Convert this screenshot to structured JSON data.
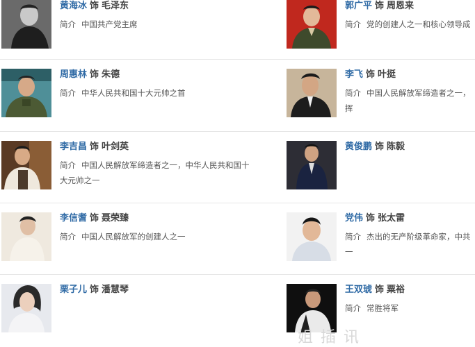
{
  "cast": [
    {
      "left": {
        "actor": "黄海冰",
        "as": "饰",
        "role": "毛泽东",
        "label": "简介",
        "desc": "中国共产党主席"
      },
      "right": {
        "actor": "郭广平",
        "as": "饰",
        "role": "周恩来",
        "label": "简介",
        "desc": "党的创建人之一和核心领导成"
      }
    },
    {
      "left": {
        "actor": "周惠林",
        "as": "饰",
        "role": "朱德",
        "label": "简介",
        "desc": "中华人民共和国十大元帅之首"
      },
      "right": {
        "actor": "李飞",
        "as": "饰",
        "role": "叶挺",
        "label": "简介",
        "desc": "中国人民解放军缔造者之一，",
        " desc2": "",
        "cont": "挥"
      }
    },
    {
      "left": {
        "actor": "李吉昌",
        "as": "饰",
        "role": "叶剑英",
        "label": "简介",
        "desc": "中国人民解放军缔造者之一，中华人民共和国十",
        "cont": "大元帅之一"
      },
      "right": {
        "actor": "黄俊鹏",
        "as": "饰",
        "role": "陈毅",
        "label": "",
        "desc": ""
      }
    },
    {
      "left": {
        "actor": "李信耆",
        "as": "饰",
        "role": "聂荣臻",
        "label": "简介",
        "desc": "中国人民解放军的创建人之一"
      },
      "right": {
        "actor": "党伟",
        "as": "饰",
        "role": "张太雷",
        "label": "简介",
        "desc": "杰出的无产阶级革命家，中共",
        "cont": "一"
      }
    },
    {
      "left": {
        "actor": "栗子儿",
        "as": "饰",
        "role": "潘慧琴",
        "label": "",
        "desc": ""
      },
      "right": {
        "actor": "王双琥",
        "as": "饰",
        "role": "粟裕",
        "label": "简介",
        "desc": "常胜将军"
      }
    }
  ],
  "watermark": "姐 插 讯",
  "colors": {
    "actor": "#2f6aa5",
    "text": "#444444",
    "desc": "#555555"
  }
}
